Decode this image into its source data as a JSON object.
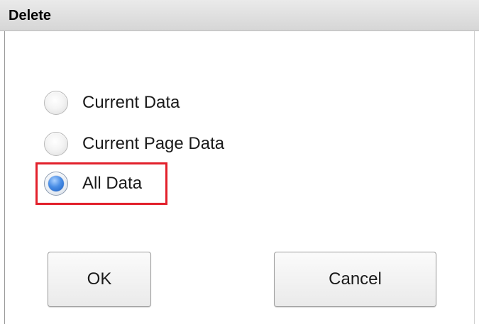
{
  "dialog": {
    "title": "Delete"
  },
  "options": [
    {
      "label": "Current Data",
      "selected": false
    },
    {
      "label": "Current Page Data",
      "selected": false
    },
    {
      "label": "All Data",
      "selected": true
    }
  ],
  "buttons": {
    "ok_label": "OK",
    "cancel_label": "Cancel"
  },
  "colors": {
    "highlight": "#e2202b",
    "radio_selected": "#2f74d6"
  },
  "icons": {
    "radio_unchecked": "radio-unchecked-icon",
    "radio_checked": "radio-checked-icon"
  }
}
